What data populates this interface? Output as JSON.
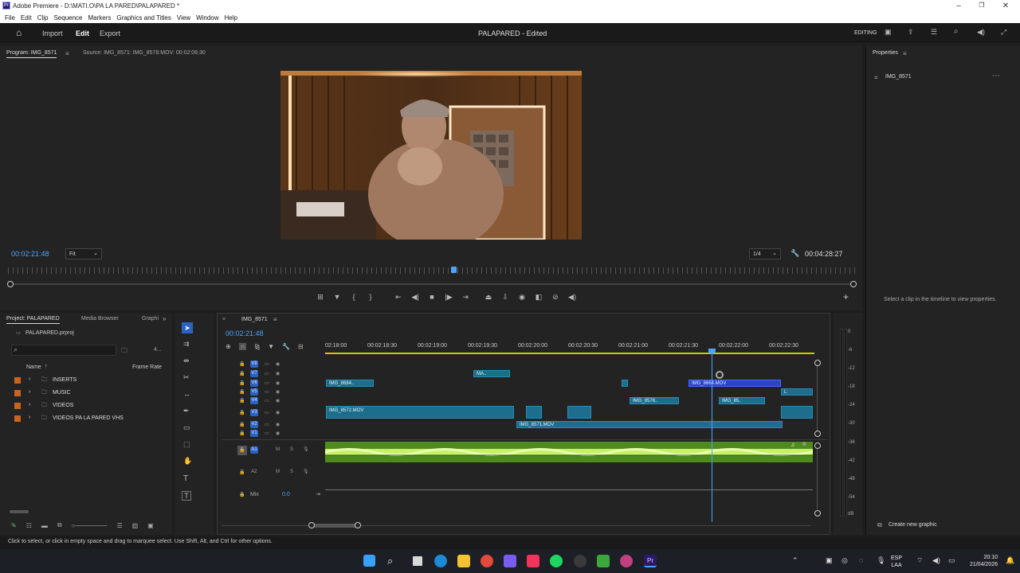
{
  "window": {
    "title": "Adobe Premiere - D:\\MATI.O\\PA LA PARED\\PALAPARED *",
    "app_icon": "Pr"
  },
  "menu": [
    "File",
    "Edit",
    "Clip",
    "Sequence",
    "Markers",
    "Graphics and Titles",
    "View",
    "Window",
    "Help"
  ],
  "header": {
    "nav": [
      "Import",
      "Edit",
      "Export"
    ],
    "active": "Edit",
    "project_title": "PALAPARED - Edited",
    "workspace": "EDITING"
  },
  "program": {
    "tab": "Program: IMG_8571",
    "source": "Source: IMG_8571: IMG_8578.MOV: 00:02:06:30",
    "timecode": "00:02:21:48",
    "fit": "Fit",
    "res": "1/4",
    "duration": "00:04:28:27"
  },
  "properties": {
    "tab": "Properties",
    "item": "IMG_8571",
    "hint": "Select a clip in the timeline to view properties.",
    "create_graphic": "Create new graphic"
  },
  "project": {
    "tabs": [
      "Project: PALAPARED",
      "Media Browser",
      "Graphi"
    ],
    "file": "PALAPARED.prproj",
    "count": "4...",
    "col_name": "Name",
    "col_rate": "Frame Rate",
    "folders": [
      "INSERTS",
      "MUSIC",
      "VIDEOS",
      "VIDEOS PA LA PARED VHS"
    ]
  },
  "timeline": {
    "tab": "IMG_8571",
    "timecode": "00:02:21:48",
    "ruler": [
      "02:18:00",
      "00:02:18:30",
      "00:02:19:00",
      "00:02:19:30",
      "00:02:20:00",
      "00:02:20:30",
      "00:02:21:00",
      "00:02:21:30",
      "00:02:22:00",
      "00:02:22:30"
    ],
    "tracks": [
      "V8",
      "V7",
      "V6",
      "V5",
      "V4",
      "V3",
      "V2",
      "V1"
    ],
    "audio": [
      "A1",
      "A2"
    ],
    "mix_label": "Mix",
    "mix_value": "0.0",
    "m": "M",
    "s": "S",
    "clips": {
      "ma": "MA..",
      "img8684": "IMG_8684..",
      "img866": "IMG_8664.MOV",
      "l": "L",
      "img8578": "IMG_8578..",
      "img85": "IMG_85..",
      "img8572": "IMG_8572.MOV",
      "img8571": "IMG_8571.MOV"
    },
    "fx": "fx"
  },
  "vu": [
    "0",
    "-6",
    "-12",
    "-18",
    "-24",
    "-30",
    "-36",
    "-42",
    "-48",
    "-54",
    "dB"
  ],
  "status": "Click to select, or click in empty space and drag to marquee select. Use Shift, Alt, and Ctrl for other options.",
  "tray": {
    "lang": "ESP",
    "layout": "LAA",
    "time": "20:10",
    "date": "21/04/2026"
  }
}
